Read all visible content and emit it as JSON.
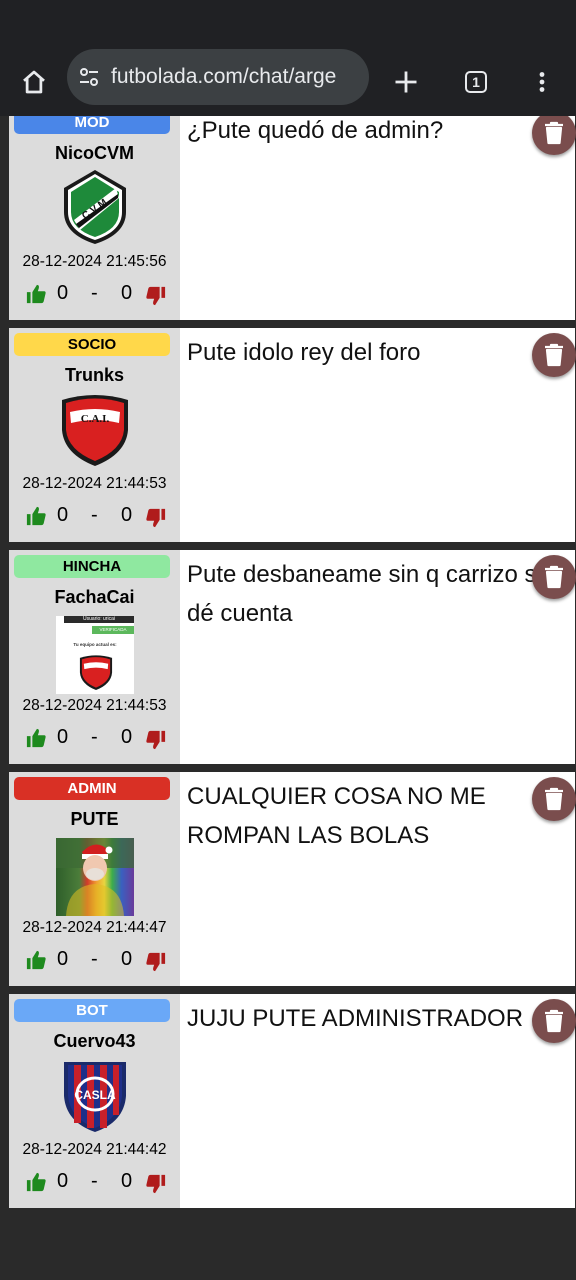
{
  "browser": {
    "url": "futbolada.com/chat/arge",
    "tab_count": "1"
  },
  "messages": [
    {
      "badge": "MOD",
      "badge_color": "#4a86e8",
      "username": "NicoCVM",
      "crest": "cvm-crest",
      "date": "28-12-2024 21:45:56",
      "likes": "0",
      "dash": "-",
      "dislikes": "0",
      "text": "¿Pute quedó de admin?"
    },
    {
      "badge": "SOCIO",
      "badge_color": "#ffd84a",
      "username": "Trunks",
      "crest": "cai-crest",
      "date": "28-12-2024 21:44:53",
      "likes": "0",
      "dash": "-",
      "dislikes": "0",
      "text": "Pute idolo rey del foro"
    },
    {
      "badge": "HINCHA",
      "badge_color": "#8fe8a0",
      "username": "FachaCai",
      "crest": "profile-screenshot",
      "date": "28-12-2024 21:44:53",
      "likes": "0",
      "dash": "-",
      "dislikes": "0",
      "text": "Pute desbaneame sin q carrizo se dé cuenta",
      "screenshot": {
        "user_line": "Usuario: uricai",
        "verified": "VERIFICADA",
        "team_line": "Tu equipo actual es:"
      }
    },
    {
      "badge": "ADMIN",
      "badge_color": "#d93025",
      "username": "PUTE",
      "crest": "user-photo",
      "date": "28-12-2024 21:44:47",
      "likes": "0",
      "dash": "-",
      "dislikes": "0",
      "text": "CUALQUIER COSA NO ME ROMPAN LAS BOLAS"
    },
    {
      "badge": "BOT",
      "badge_color": "#6aa8f7",
      "username": "Cuervo43",
      "crest": "casla-crest",
      "date": "28-12-2024 21:44:42",
      "likes": "0",
      "dash": "-",
      "dislikes": "0",
      "text": "JUJU PUTE ADMINISTRADOR"
    }
  ],
  "colors": {
    "like": "#1e8a1e",
    "dislike": "#b01c1c",
    "trash": "#7a4d4d"
  }
}
